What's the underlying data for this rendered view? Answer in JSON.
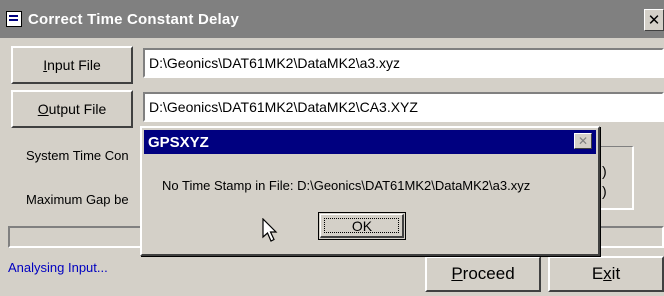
{
  "window": {
    "title": "Correct Time Constant Delay",
    "close_glyph": "✕"
  },
  "input_file": {
    "button_label_prefix": "",
    "button_label_mnemonic": "I",
    "button_label_rest": "nput File",
    "value": "D:\\Geonics\\DAT61MK2\\DataMK2\\a3.xyz"
  },
  "output_file": {
    "button_label_mnemonic": "O",
    "button_label_rest": "utput File",
    "value": "D:\\Geonics\\DAT61MK2\\DataMK2\\CA3.XYZ"
  },
  "labels": {
    "system_time_constant": "System Time Con",
    "maximum_gap": "Maximum Gap be"
  },
  "status_text": "Analysing Input...",
  "buttons": {
    "proceed_mnemonic": "P",
    "proceed_rest": "roceed",
    "exit_prefix": "E",
    "exit_mnemonic": "x",
    "exit_rest": "it"
  },
  "hidden_fragments": {
    "fragment_1": ")",
    "fragment_2": ")"
  },
  "dialog": {
    "title": "GPSXYZ",
    "close_glyph": "✕",
    "message": "No Time Stamp in File: D:\\Geonics\\DAT61MK2\\DataMK2\\a3.xyz",
    "ok_label": "OK"
  }
}
